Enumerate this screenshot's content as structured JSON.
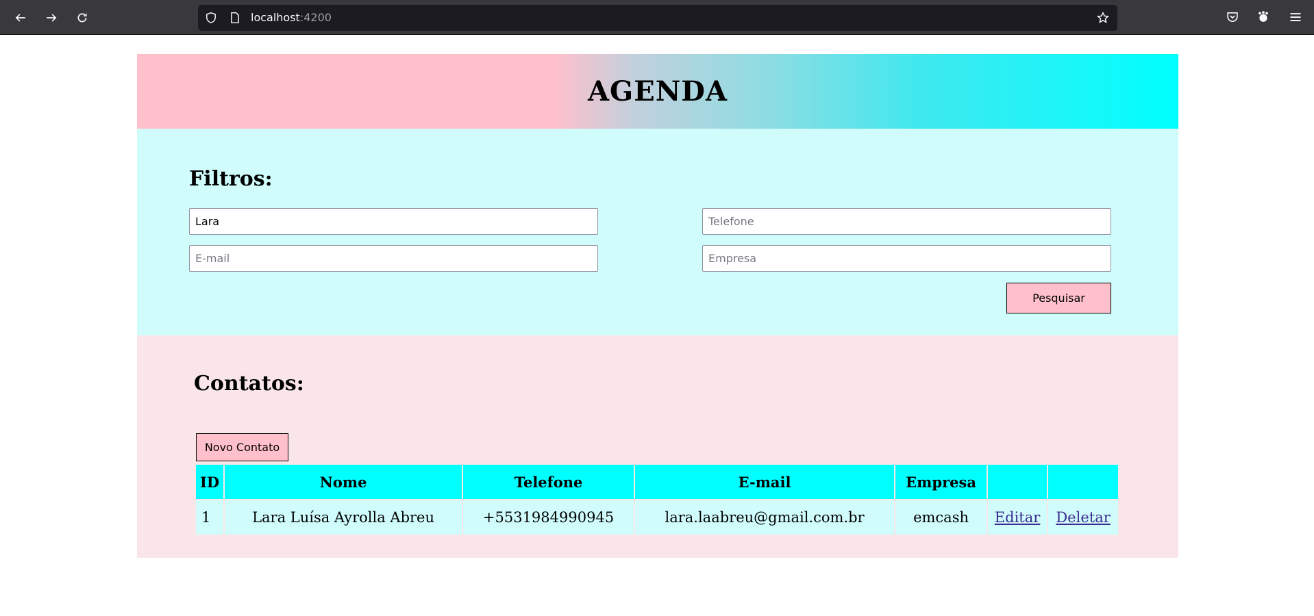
{
  "browser": {
    "url_host": "localhost",
    "url_port": ":4200"
  },
  "header": {
    "title": "AGENDA",
    "gradient": [
      "#ffc0cb",
      "#00ffff"
    ]
  },
  "filters": {
    "title": "Filtros:",
    "nome_value": "Lara",
    "telefone_placeholder": "Telefone",
    "email_placeholder": "E-mail",
    "empresa_placeholder": "Empresa",
    "search_label": "Pesquisar"
  },
  "contacts": {
    "title": "Contatos:",
    "new_label": "Novo Contato",
    "columns": [
      "ID",
      "Nome",
      "Telefone",
      "E-mail",
      "Empresa",
      "",
      ""
    ],
    "rows": [
      {
        "id": "1",
        "nome": "Lara Luísa Ayrolla Abreu",
        "telefone": "+5531984990945",
        "email": "lara.laabreu@gmail.com.br",
        "empresa": "emcash",
        "edit_label": "Editar",
        "delete_label": "Deletar"
      }
    ]
  },
  "colors": {
    "accent_cyan": "#00ffff",
    "accent_pink": "#ffc0cb",
    "filters_bg": "#d0fcfc",
    "contacts_bg": "#fae6e9"
  }
}
